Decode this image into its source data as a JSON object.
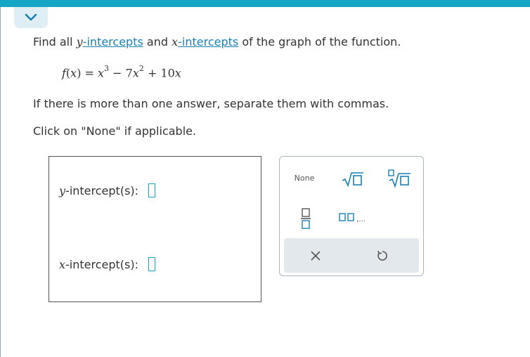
{
  "question": {
    "prefix": "Find all ",
    "y_var": "y",
    "y_term": "-intercepts",
    "mid": " and ",
    "x_var": "x",
    "x_term": "-intercepts",
    "suffix": " of the graph of the function."
  },
  "formula": {
    "fname": "f",
    "arg": "x",
    "lhs_close": ") = ",
    "t1": "x",
    "t1_exp": "3",
    "op1": " − 7",
    "t2": "x",
    "t2_exp": "2",
    "op2": " + 10",
    "t3": "x"
  },
  "instructions": {
    "line1": "If there is more than one answer, separate them with commas.",
    "line2": "Click on \"None\" if applicable."
  },
  "answers": {
    "y_var": "y",
    "y_label": "-intercept(s):",
    "x_var": "x",
    "x_label": "-intercept(s):"
  },
  "keypad": {
    "none_label": "None",
    "list_dots": ",..."
  },
  "colors": {
    "accent": "#16a6c5",
    "link": "#1a7fb5",
    "keypad_footer": "#e3e8ec"
  },
  "icons": {
    "collapse": "chevron-down-icon",
    "sqrt": "square-root-icon",
    "nroot": "nth-root-icon",
    "frac": "fraction-icon",
    "list": "list-icon",
    "clear": "close-icon",
    "undo": "undo-icon"
  }
}
